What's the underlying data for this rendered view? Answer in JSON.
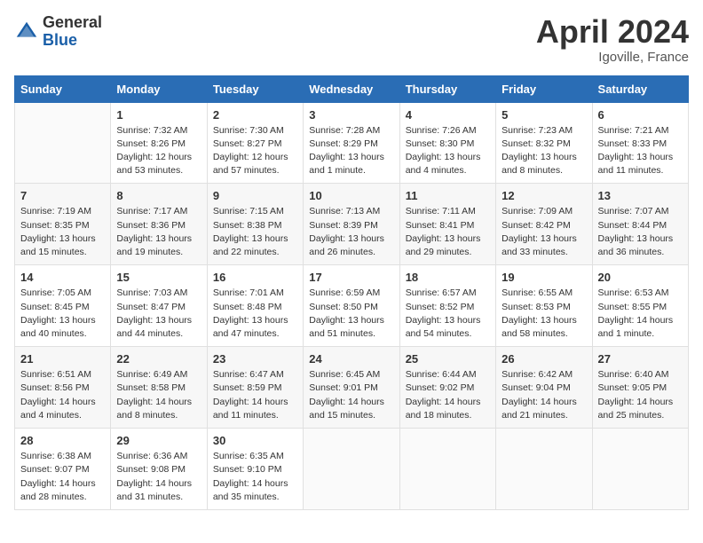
{
  "header": {
    "logo_general": "General",
    "logo_blue": "Blue",
    "month_title": "April 2024",
    "location": "Igoville, France"
  },
  "weekdays": [
    "Sunday",
    "Monday",
    "Tuesday",
    "Wednesday",
    "Thursday",
    "Friday",
    "Saturday"
  ],
  "weeks": [
    [
      {
        "day": "",
        "info": ""
      },
      {
        "day": "1",
        "info": "Sunrise: 7:32 AM\nSunset: 8:26 PM\nDaylight: 12 hours\nand 53 minutes."
      },
      {
        "day": "2",
        "info": "Sunrise: 7:30 AM\nSunset: 8:27 PM\nDaylight: 12 hours\nand 57 minutes."
      },
      {
        "day": "3",
        "info": "Sunrise: 7:28 AM\nSunset: 8:29 PM\nDaylight: 13 hours\nand 1 minute."
      },
      {
        "day": "4",
        "info": "Sunrise: 7:26 AM\nSunset: 8:30 PM\nDaylight: 13 hours\nand 4 minutes."
      },
      {
        "day": "5",
        "info": "Sunrise: 7:23 AM\nSunset: 8:32 PM\nDaylight: 13 hours\nand 8 minutes."
      },
      {
        "day": "6",
        "info": "Sunrise: 7:21 AM\nSunset: 8:33 PM\nDaylight: 13 hours\nand 11 minutes."
      }
    ],
    [
      {
        "day": "7",
        "info": "Sunrise: 7:19 AM\nSunset: 8:35 PM\nDaylight: 13 hours\nand 15 minutes."
      },
      {
        "day": "8",
        "info": "Sunrise: 7:17 AM\nSunset: 8:36 PM\nDaylight: 13 hours\nand 19 minutes."
      },
      {
        "day": "9",
        "info": "Sunrise: 7:15 AM\nSunset: 8:38 PM\nDaylight: 13 hours\nand 22 minutes."
      },
      {
        "day": "10",
        "info": "Sunrise: 7:13 AM\nSunset: 8:39 PM\nDaylight: 13 hours\nand 26 minutes."
      },
      {
        "day": "11",
        "info": "Sunrise: 7:11 AM\nSunset: 8:41 PM\nDaylight: 13 hours\nand 29 minutes."
      },
      {
        "day": "12",
        "info": "Sunrise: 7:09 AM\nSunset: 8:42 PM\nDaylight: 13 hours\nand 33 minutes."
      },
      {
        "day": "13",
        "info": "Sunrise: 7:07 AM\nSunset: 8:44 PM\nDaylight: 13 hours\nand 36 minutes."
      }
    ],
    [
      {
        "day": "14",
        "info": "Sunrise: 7:05 AM\nSunset: 8:45 PM\nDaylight: 13 hours\nand 40 minutes."
      },
      {
        "day": "15",
        "info": "Sunrise: 7:03 AM\nSunset: 8:47 PM\nDaylight: 13 hours\nand 44 minutes."
      },
      {
        "day": "16",
        "info": "Sunrise: 7:01 AM\nSunset: 8:48 PM\nDaylight: 13 hours\nand 47 minutes."
      },
      {
        "day": "17",
        "info": "Sunrise: 6:59 AM\nSunset: 8:50 PM\nDaylight: 13 hours\nand 51 minutes."
      },
      {
        "day": "18",
        "info": "Sunrise: 6:57 AM\nSunset: 8:52 PM\nDaylight: 13 hours\nand 54 minutes."
      },
      {
        "day": "19",
        "info": "Sunrise: 6:55 AM\nSunset: 8:53 PM\nDaylight: 13 hours\nand 58 minutes."
      },
      {
        "day": "20",
        "info": "Sunrise: 6:53 AM\nSunset: 8:55 PM\nDaylight: 14 hours\nand 1 minute."
      }
    ],
    [
      {
        "day": "21",
        "info": "Sunrise: 6:51 AM\nSunset: 8:56 PM\nDaylight: 14 hours\nand 4 minutes."
      },
      {
        "day": "22",
        "info": "Sunrise: 6:49 AM\nSunset: 8:58 PM\nDaylight: 14 hours\nand 8 minutes."
      },
      {
        "day": "23",
        "info": "Sunrise: 6:47 AM\nSunset: 8:59 PM\nDaylight: 14 hours\nand 11 minutes."
      },
      {
        "day": "24",
        "info": "Sunrise: 6:45 AM\nSunset: 9:01 PM\nDaylight: 14 hours\nand 15 minutes."
      },
      {
        "day": "25",
        "info": "Sunrise: 6:44 AM\nSunset: 9:02 PM\nDaylight: 14 hours\nand 18 minutes."
      },
      {
        "day": "26",
        "info": "Sunrise: 6:42 AM\nSunset: 9:04 PM\nDaylight: 14 hours\nand 21 minutes."
      },
      {
        "day": "27",
        "info": "Sunrise: 6:40 AM\nSunset: 9:05 PM\nDaylight: 14 hours\nand 25 minutes."
      }
    ],
    [
      {
        "day": "28",
        "info": "Sunrise: 6:38 AM\nSunset: 9:07 PM\nDaylight: 14 hours\nand 28 minutes."
      },
      {
        "day": "29",
        "info": "Sunrise: 6:36 AM\nSunset: 9:08 PM\nDaylight: 14 hours\nand 31 minutes."
      },
      {
        "day": "30",
        "info": "Sunrise: 6:35 AM\nSunset: 9:10 PM\nDaylight: 14 hours\nand 35 minutes."
      },
      {
        "day": "",
        "info": ""
      },
      {
        "day": "",
        "info": ""
      },
      {
        "day": "",
        "info": ""
      },
      {
        "day": "",
        "info": ""
      }
    ]
  ]
}
